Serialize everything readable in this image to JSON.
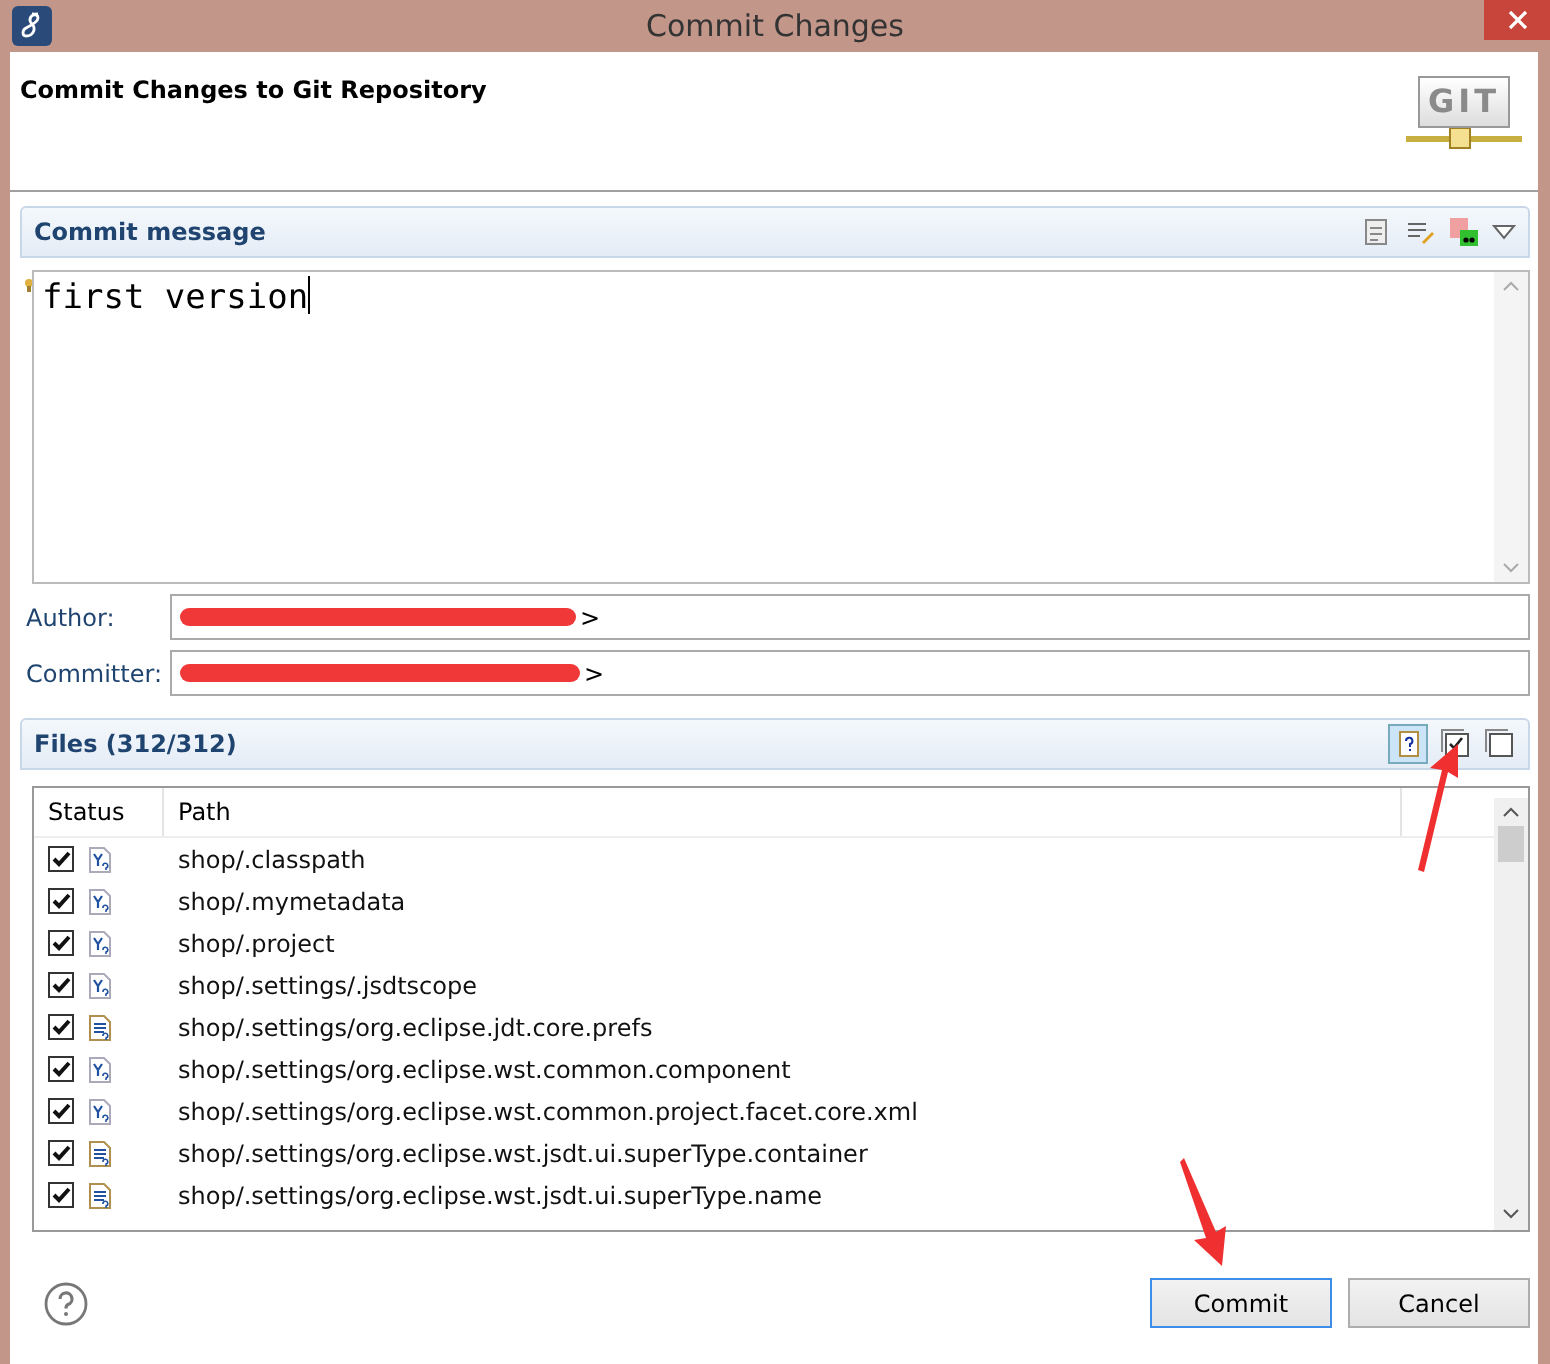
{
  "window": {
    "title": "Commit Changes"
  },
  "header": {
    "title": "Commit Changes to Git Repository",
    "logo": "GIT"
  },
  "commit_message": {
    "title": "Commit message",
    "value": "first version"
  },
  "author": {
    "label": "Author:",
    "value": ">"
  },
  "committer": {
    "label": "Committer:",
    "value": ">"
  },
  "files": {
    "title": "Files (312/312)",
    "columns": [
      "Status",
      "Path"
    ],
    "rows": [
      {
        "kind": "yfile",
        "checked": true,
        "path": "shop/.classpath"
      },
      {
        "kind": "yfile",
        "checked": true,
        "path": "shop/.mymetadata"
      },
      {
        "kind": "yfile",
        "checked": true,
        "path": "shop/.project"
      },
      {
        "kind": "yfile",
        "checked": true,
        "path": "shop/.settings/.jsdtscope"
      },
      {
        "kind": "textfile",
        "checked": true,
        "path": "shop/.settings/org.eclipse.jdt.core.prefs"
      },
      {
        "kind": "yfile",
        "checked": true,
        "path": "shop/.settings/org.eclipse.wst.common.component"
      },
      {
        "kind": "yfile",
        "checked": true,
        "path": "shop/.settings/org.eclipse.wst.common.project.facet.core.xml"
      },
      {
        "kind": "textfile",
        "checked": true,
        "path": "shop/.settings/org.eclipse.wst.jsdt.ui.superType.container"
      },
      {
        "kind": "textfile",
        "checked": true,
        "path": "shop/.settings/org.eclipse.wst.jsdt.ui.superType.name"
      }
    ]
  },
  "buttons": [
    {
      "label": "Commit",
      "selected": true
    },
    {
      "label": "Cancel",
      "selected": false
    }
  ]
}
